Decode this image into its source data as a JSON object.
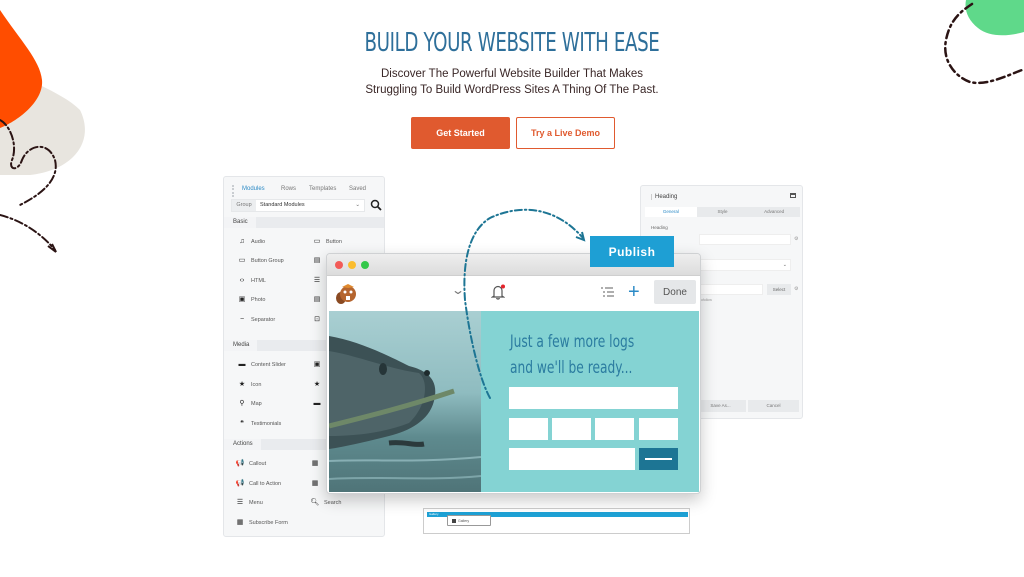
{
  "hero": {
    "title": "BUILD YOUR WEBSITE WITH EASE",
    "subtitle_line1": "Discover The Powerful Website Builder That Makes",
    "subtitle_line2": "Struggling To Build WordPress Sites A Thing Of The Past.",
    "primary_button": "Get Started",
    "secondary_button": "Try a Live Demo"
  },
  "colors": {
    "accent_orange": "#e05a2f",
    "title_blue": "#2e6f9a",
    "publish_blue": "#1e9fd4",
    "teal_bg": "#84d3d3",
    "green_blob": "#5fd98a"
  },
  "modules_panel": {
    "tabs": [
      "Modules",
      "Rows",
      "Templates",
      "Saved"
    ],
    "active_tab": "Modules",
    "group_label": "Group",
    "group_value": "Standard Modules",
    "sections": [
      {
        "name": "Basic",
        "items": [
          {
            "label": "Audio",
            "icon": "music-icon"
          },
          {
            "label": "Button",
            "icon": "button-icon"
          },
          {
            "label": "Button Group",
            "icon": "button-group-icon"
          },
          {
            "label": "",
            "icon": "text-editor-icon"
          },
          {
            "label": "HTML",
            "icon": "code-icon"
          },
          {
            "label": "",
            "icon": "list-icon"
          },
          {
            "label": "Photo",
            "icon": "photo-icon"
          },
          {
            "label": "",
            "icon": "text-icon"
          },
          {
            "label": "Separator",
            "icon": "separator-icon"
          },
          {
            "label": "",
            "icon": "video-icon"
          }
        ]
      },
      {
        "name": "Media",
        "items": [
          {
            "label": "Content Slider",
            "icon": "slider-icon"
          },
          {
            "label": "",
            "icon": "gallery-icon"
          },
          {
            "label": "Icon",
            "icon": "star-icon"
          },
          {
            "label": "",
            "icon": "star-icon"
          },
          {
            "label": "Map",
            "icon": "map-pin-icon"
          },
          {
            "label": "",
            "icon": "slider-icon"
          },
          {
            "label": "Testimonials",
            "icon": "quote-icon"
          }
        ]
      },
      {
        "name": "Actions",
        "items": [
          {
            "label": "Callout",
            "icon": "megaphone-icon"
          },
          {
            "label": "",
            "icon": "layout-icon"
          },
          {
            "label": "Call to Action",
            "icon": "megaphone-icon"
          },
          {
            "label": "",
            "icon": "layout-icon"
          },
          {
            "label": "Menu",
            "icon": "menu-icon"
          },
          {
            "label": "Search",
            "icon": "search-icon"
          },
          {
            "label": "Subscribe Form",
            "icon": "form-icon"
          }
        ]
      }
    ]
  },
  "settings_panel": {
    "title": "Heading",
    "tabs": [
      "General",
      "Style",
      "Advanced"
    ],
    "active_tab": "General",
    "field_label": "Heading",
    "select_button": "Select",
    "hint": "nofollow",
    "footer_buttons": [
      "Save As...",
      "Cancel"
    ]
  },
  "gallery_strip": {
    "bar_label": "Gallery",
    "chip_label": "Gallery"
  },
  "browser": {
    "done_button": "Done",
    "headline_line1": "Just a few more logs",
    "headline_line2": "and we'll be ready..."
  },
  "publish_button": "Publish"
}
